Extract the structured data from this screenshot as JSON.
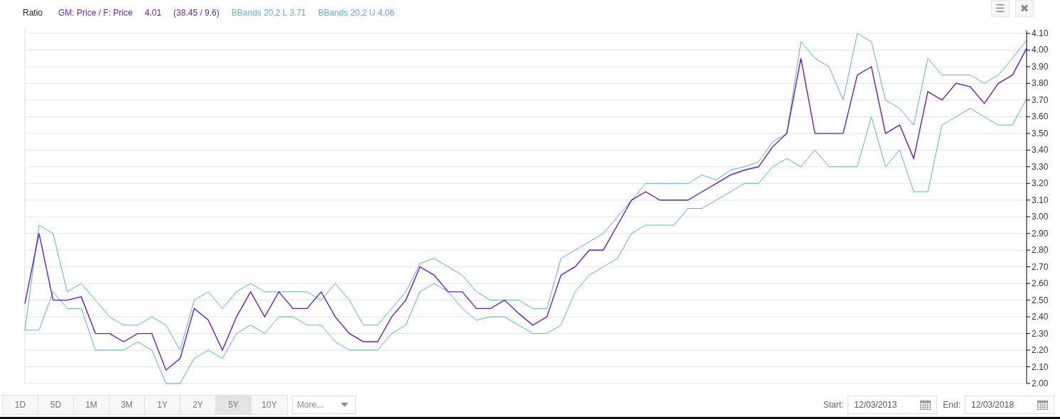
{
  "legend": {
    "title": "Ratio",
    "items": [
      {
        "label": "GM: Price / F: Price",
        "color": "#5a1fd6"
      },
      {
        "label": "4.01",
        "color": "#5a1fd6"
      },
      {
        "label": "(38.45 / 9.6)",
        "color": "#5a1fd6"
      },
      {
        "label": "BBands 20,2 L 3.71",
        "color": "#5ab4c1"
      },
      {
        "label": "BBands 20,2 U 4.06",
        "color": "#5ab4c1"
      }
    ]
  },
  "toolbar": {
    "menu_button": "☰",
    "close_button": "✖"
  },
  "chart_data": {
    "type": "line",
    "grid": true,
    "ylim": [
      2.0,
      4.1
    ],
    "yticks": [
      {
        "value": 2.0,
        "label": "2.00"
      },
      {
        "value": 2.1,
        "label": "2.10"
      },
      {
        "value": 2.2,
        "label": "2.20"
      },
      {
        "value": 2.3,
        "label": "2.30"
      },
      {
        "value": 2.4,
        "label": "2.40"
      },
      {
        "value": 2.5,
        "label": "2.50"
      },
      {
        "value": 2.6,
        "label": "2.60"
      },
      {
        "value": 2.7,
        "label": "2.70"
      },
      {
        "value": 2.8,
        "label": "2.80"
      },
      {
        "value": 2.9,
        "label": "2.90"
      },
      {
        "value": 3.0,
        "label": "3.00"
      },
      {
        "value": 3.1,
        "label": "3.10"
      },
      {
        "value": 3.2,
        "label": "3.20"
      },
      {
        "value": 3.3,
        "label": "3.30"
      },
      {
        "value": 3.4,
        "label": "3.40"
      },
      {
        "value": 3.5,
        "label": "3.50"
      },
      {
        "value": 3.6,
        "label": "3.60"
      },
      {
        "value": 3.7,
        "label": "3.70"
      },
      {
        "value": 3.8,
        "label": "3.80"
      },
      {
        "value": 3.9,
        "label": "3.90"
      },
      {
        "value": 4.0,
        "label": "4.00"
      },
      {
        "value": 4.1,
        "label": "4.10"
      }
    ],
    "series": [
      {
        "color": "#5ab4c1",
        "values": [
          2.32,
          2.95,
          2.9,
          2.55,
          2.6,
          2.5,
          2.4,
          2.35,
          2.35,
          2.4,
          2.35,
          2.2,
          2.5,
          2.55,
          2.45,
          2.55,
          2.6,
          2.55,
          2.55,
          2.55,
          2.55,
          2.5,
          2.6,
          2.5,
          2.35,
          2.35,
          2.45,
          2.55,
          2.72,
          2.75,
          2.7,
          2.65,
          2.55,
          2.5,
          2.5,
          2.5,
          2.45,
          2.45,
          2.75,
          2.8,
          2.85,
          2.9,
          3.0,
          3.1,
          3.2,
          3.2,
          3.2,
          3.2,
          3.25,
          3.22,
          3.28,
          3.3,
          3.33,
          3.45,
          3.5,
          4.05,
          3.95,
          3.9,
          3.7,
          4.1,
          4.05,
          3.7,
          3.65,
          3.55,
          3.95,
          3.85,
          3.85,
          3.85,
          3.8,
          3.85,
          3.95,
          4.06
        ]
      },
      {
        "color": "#5ab4c1",
        "values": [
          2.32,
          2.32,
          2.55,
          2.45,
          2.45,
          2.2,
          2.2,
          2.2,
          2.25,
          2.2,
          2.0,
          2.0,
          2.15,
          2.2,
          2.15,
          2.3,
          2.35,
          2.3,
          2.4,
          2.4,
          2.35,
          2.35,
          2.25,
          2.2,
          2.2,
          2.2,
          2.3,
          2.35,
          2.55,
          2.6,
          2.55,
          2.45,
          2.38,
          2.4,
          2.4,
          2.35,
          2.3,
          2.3,
          2.35,
          2.55,
          2.65,
          2.7,
          2.75,
          2.9,
          2.95,
          2.95,
          2.95,
          3.05,
          3.05,
          3.1,
          3.15,
          3.2,
          3.2,
          3.3,
          3.35,
          3.3,
          3.4,
          3.3,
          3.3,
          3.3,
          3.6,
          3.3,
          3.4,
          3.15,
          3.15,
          3.55,
          3.6,
          3.65,
          3.6,
          3.55,
          3.55,
          3.71
        ]
      },
      {
        "color": "#5a1fd6",
        "values": [
          2.48,
          2.9,
          2.5,
          2.5,
          2.52,
          2.3,
          2.3,
          2.25,
          2.3,
          2.3,
          2.08,
          2.15,
          2.45,
          2.38,
          2.2,
          2.4,
          2.55,
          2.4,
          2.55,
          2.45,
          2.45,
          2.55,
          2.4,
          2.3,
          2.25,
          2.25,
          2.4,
          2.5,
          2.7,
          2.65,
          2.55,
          2.55,
          2.45,
          2.45,
          2.5,
          2.42,
          2.35,
          2.4,
          2.65,
          2.7,
          2.8,
          2.8,
          2.95,
          3.1,
          3.15,
          3.1,
          3.1,
          3.1,
          3.15,
          3.2,
          3.25,
          3.28,
          3.3,
          3.42,
          3.5,
          3.95,
          3.5,
          3.5,
          3.5,
          3.85,
          3.9,
          3.5,
          3.55,
          3.35,
          3.75,
          3.7,
          3.8,
          3.78,
          3.68,
          3.8,
          3.85,
          4.01
        ]
      }
    ]
  },
  "ranges": [
    {
      "label": "1D",
      "selected": false
    },
    {
      "label": "5D",
      "selected": false
    },
    {
      "label": "1M",
      "selected": false
    },
    {
      "label": "3M",
      "selected": false
    },
    {
      "label": "1Y",
      "selected": false
    },
    {
      "label": "2Y",
      "selected": false
    },
    {
      "label": "5Y",
      "selected": true
    },
    {
      "label": "10Y",
      "selected": false
    }
  ],
  "more_dropdown": {
    "value": "More..."
  },
  "start": {
    "label": "Start:",
    "value": "12/03/2013"
  },
  "end": {
    "label": "End:",
    "value": "12/03/2018"
  }
}
